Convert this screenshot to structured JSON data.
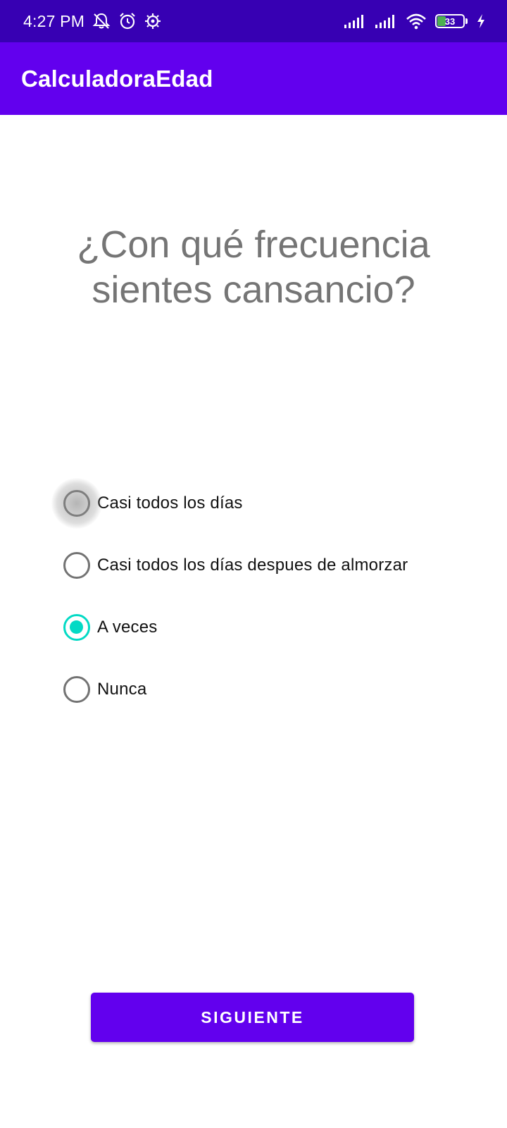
{
  "status_bar": {
    "time": "4:27 PM",
    "left_icons": [
      "notifications-off-icon",
      "alarm-icon",
      "settings-icon"
    ],
    "right_icons": [
      "signal-icon",
      "signal-icon",
      "wifi-icon",
      "battery-icon",
      "charging-icon"
    ],
    "battery_level": "33"
  },
  "app_bar": {
    "title": "CalculadoraEdad"
  },
  "question": {
    "text": "¿Con qué frecuencia sientes cansancio?"
  },
  "options": [
    {
      "label": "Casi todos los días",
      "checked": false,
      "pressed": true
    },
    {
      "label": "Casi todos los días despues de almorzar",
      "checked": false,
      "pressed": false
    },
    {
      "label": "A veces",
      "checked": true,
      "pressed": false
    },
    {
      "label": "Nunca",
      "checked": false,
      "pressed": false
    }
  ],
  "next_button": {
    "label": "SIGUIENTE"
  },
  "colors": {
    "status_bar": "#3700b3",
    "app_bar": "#6200ee",
    "accent": "#03dac5",
    "button": "#6200ee"
  }
}
